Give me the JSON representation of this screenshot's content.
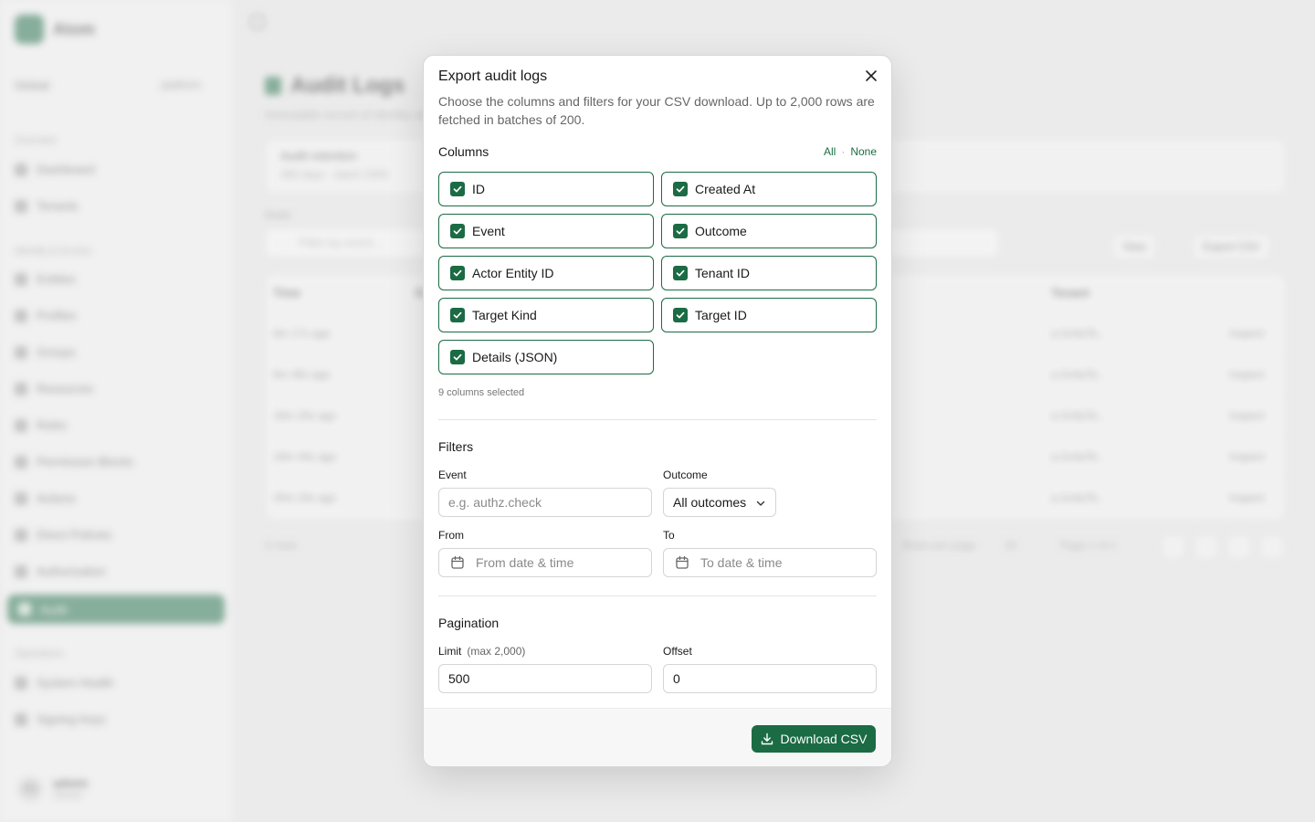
{
  "background": {
    "brand": "Atom",
    "scope": {
      "label": "Global",
      "value": "platform"
    },
    "sidebar": {
      "sections": [
        {
          "label": "Overview",
          "items": [
            "Dashboard",
            "Tenants"
          ]
        },
        {
          "label": "Identity & Access",
          "items": [
            "Entities",
            "Profiles",
            "Groups",
            "Resources",
            "Roles",
            "Permission Blocks",
            "Actions",
            "Direct Policies",
            "Authorization",
            "Audit"
          ]
        },
        {
          "label": "Operations",
          "items": [
            "System Health",
            "Signing Keys"
          ]
        }
      ],
      "active_item": "Audit",
      "user": {
        "initials": "AD",
        "name": "admin",
        "role": "Owner"
      }
    },
    "page": {
      "title": "Audit Logs",
      "subtitle": "Immutable record of identity and access activity",
      "retention": {
        "title": "Audit retention",
        "detail": "365 days · batch 2000"
      },
      "filter_label": "Event",
      "filter_placeholder": "Filter by event...",
      "view_label": "View",
      "export_label": "Export CSV",
      "columns": [
        "Time",
        "Event",
        "Tenant"
      ],
      "rows": [
        {
          "time": "6m 17s ago",
          "tenant": "a-2c4a7b...",
          "action": "Inspect"
        },
        {
          "time": "6m 46s ago",
          "tenant": "a-2c4a7b...",
          "action": "Inspect"
        },
        {
          "time": "16m 20s ago",
          "tenant": "a-2c4a7b...",
          "action": "Inspect"
        },
        {
          "time": "19m 44s ago",
          "tenant": "a-2c4a7b...",
          "action": "Inspect"
        },
        {
          "time": "20m 24s ago",
          "tenant": "a-2c4a7b...",
          "action": "Inspect"
        }
      ],
      "row_count": "5 rows",
      "rows_per_page_label": "Rows per page",
      "rows_per_page": "20",
      "page_info": "Page 1 of 1"
    }
  },
  "modal": {
    "title": "Export audit logs",
    "description": "Choose the columns and filters for your CSV download. Up to 2,000 rows are fetched in batches of 200.",
    "columns_section": {
      "title": "Columns",
      "all_label": "All",
      "separator": "·",
      "none_label": "None",
      "options": [
        {
          "label": "ID",
          "checked": true
        },
        {
          "label": "Created At",
          "checked": true
        },
        {
          "label": "Event",
          "checked": true
        },
        {
          "label": "Outcome",
          "checked": true
        },
        {
          "label": "Actor Entity ID",
          "checked": true
        },
        {
          "label": "Tenant ID",
          "checked": true
        },
        {
          "label": "Target Kind",
          "checked": true
        },
        {
          "label": "Target ID",
          "checked": true
        },
        {
          "label": "Details (JSON)",
          "checked": true
        }
      ],
      "selected_count": "9 columns selected"
    },
    "filters_section": {
      "title": "Filters",
      "event_label": "Event",
      "event_placeholder": "e.g. authz.check",
      "event_value": "",
      "outcome_label": "Outcome",
      "outcome_value": "All outcomes",
      "from_label": "From",
      "from_placeholder": "From date & time",
      "to_label": "To",
      "to_placeholder": "To date & time"
    },
    "pagination_section": {
      "title": "Pagination",
      "limit_label": "Limit",
      "limit_hint": "(max 2,000)",
      "limit_value": "500",
      "offset_label": "Offset",
      "offset_value": "0"
    },
    "download_label": "Download CSV"
  },
  "colors": {
    "accent": "#1b6b44",
    "muted_text": "#666666",
    "border": "#d5d5d5"
  },
  "icons": [
    "close-icon",
    "check-icon",
    "chevron-down-icon",
    "calendar-icon",
    "download-icon"
  ]
}
